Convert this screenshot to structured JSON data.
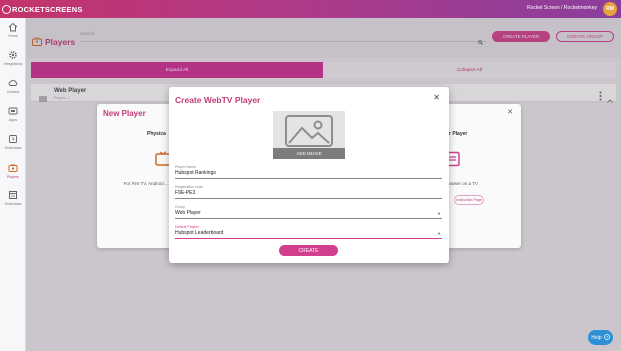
{
  "app": {
    "brand": "ROCKETSCREENS",
    "account": "Rocket Screen / Rocketmonkey",
    "avatar_initials": "RM"
  },
  "sidebar": {
    "items": [
      {
        "label": "Home",
        "icon": "home-icon"
      },
      {
        "label": "Integrations",
        "icon": "gear-icon"
      },
      {
        "label": "Content",
        "icon": "cloud-icon"
      },
      {
        "label": "Apps",
        "icon": "apps-icon"
      },
      {
        "label": "Schedules",
        "icon": "schedule-icon"
      },
      {
        "label": "Players",
        "icon": "tv-icon",
        "active": true
      },
      {
        "label": "Schedules",
        "icon": "calendar-icon"
      }
    ]
  },
  "header": {
    "title": "Players",
    "search_placeholder": "Search",
    "create_player_label": "CREATE PLAYER",
    "create_group_label": "CREATE GROUP"
  },
  "main": {
    "expand_all": "Expand All",
    "collapse_all": "Collapse All",
    "group_name": "Web Player",
    "group_sub": "Players: 1"
  },
  "new_player_modal": {
    "title": "New Player",
    "left_heading": "Physica",
    "left_desc": "For Fire TV, Android ... Pla",
    "right_heading": "r Player",
    "right_desc": "owser on a TV",
    "right_button": "Instruction Page"
  },
  "webtv_modal": {
    "title": "Create WebTV Player",
    "image_button": "ADD IMAGE",
    "fields": [
      {
        "label": "Player Name",
        "value": "Hubspot Rankings"
      },
      {
        "label": "Registration code",
        "value": "F9E-PE3"
      },
      {
        "label": "Group",
        "value": "Web Player"
      },
      {
        "label": "Default Playlist",
        "value": "Hubspot Leaderboard"
      }
    ],
    "create_label": "CREATE"
  },
  "help": {
    "label": "Help"
  },
  "colors": {
    "accent": "#d23f8c",
    "brand_text": "#c23b7a",
    "help": "#2e8fd6"
  }
}
